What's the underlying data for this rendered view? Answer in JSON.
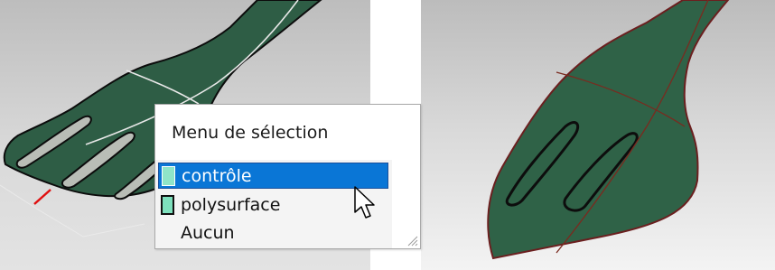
{
  "popup_menu": {
    "title": "Menu de sélection",
    "items": [
      {
        "label": "contrôle",
        "swatch": "#8fe5c8",
        "selected": true
      },
      {
        "label": "polysurface",
        "swatch": "#7ee0bd",
        "selected": false
      },
      {
        "label": "Aucun",
        "swatch": null,
        "selected": false
      }
    ]
  },
  "colors": {
    "surface_green": "#2e5d45",
    "surface_edge_red": "#6b1f1f",
    "selection_blue": "#0a76d6",
    "viewport_background": "#d4d4d4"
  },
  "icons": [
    "mouse-pointer-icon",
    "resize-grip-icon"
  ]
}
